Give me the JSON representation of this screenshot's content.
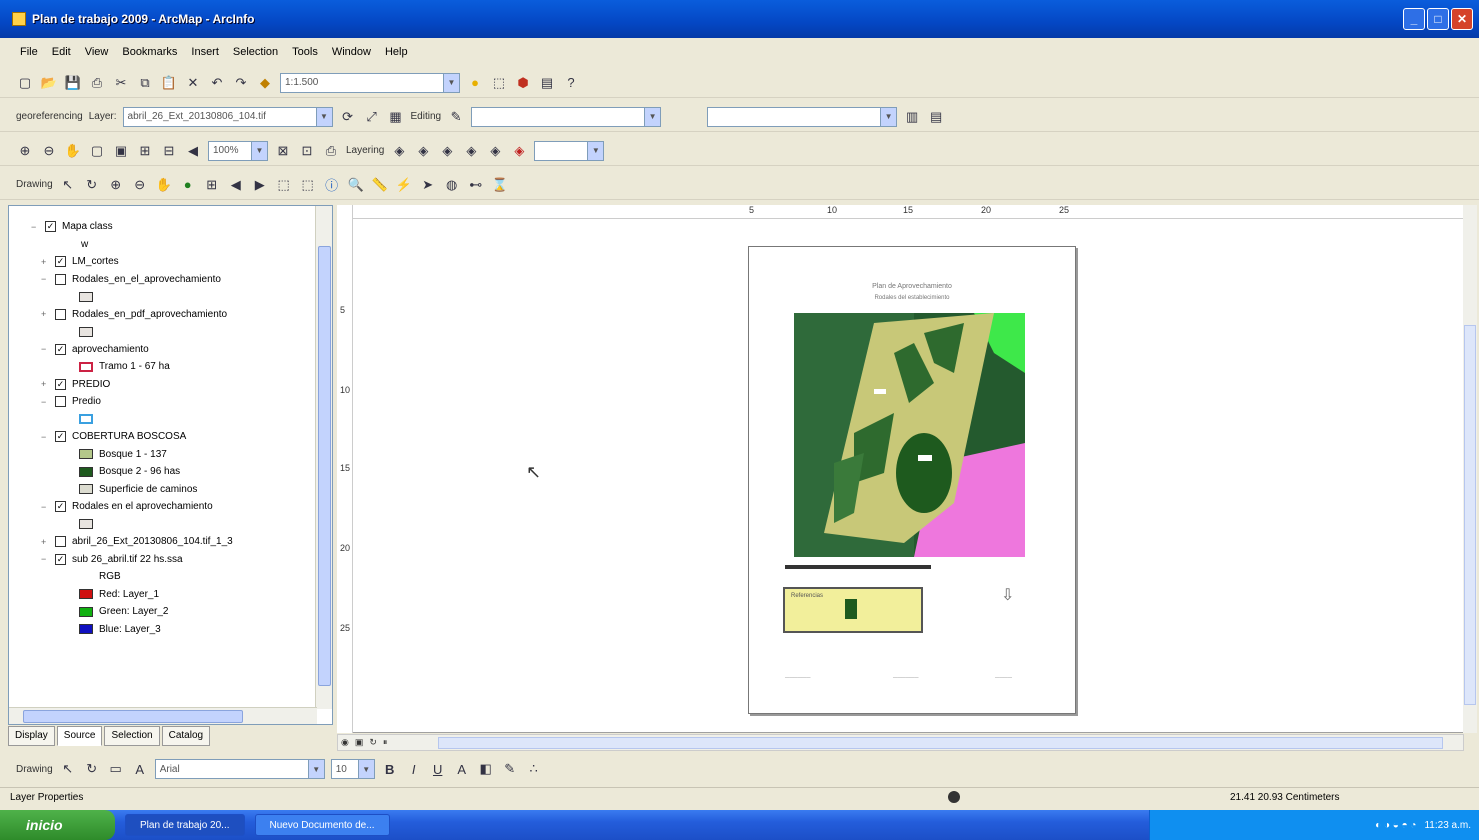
{
  "window": {
    "title": "Plan de trabajo 2009 - ArcMap - ArcInfo"
  },
  "menu": [
    "File",
    "Edit",
    "View",
    "Bookmarks",
    "Insert",
    "Selection",
    "Tools",
    "Window",
    "Help"
  ],
  "toolbar1": {
    "scale": "1:1.500"
  },
  "toolbar2": {
    "label": "georeferencing",
    "layer": "Layer:",
    "layer_value": "abril_26_Ext_20130806_104.tif",
    "task": "Editing"
  },
  "toolbar3": {
    "zoom": "100%",
    "layering": "Layering"
  },
  "toolbar4": {
    "label": "Drawing"
  },
  "toc": {
    "items": [
      {
        "label": "Mapa class",
        "type": "group",
        "checked": true
      },
      {
        "label": "w",
        "type": "text"
      },
      {
        "label": "LM_cortes",
        "type": "layer",
        "checked": true
      },
      {
        "label": "Rodales_en_el_aprovechamiento",
        "type": "layer",
        "checked": false
      },
      {
        "label": "",
        "type": "swatch",
        "color": "#e8e4e0"
      },
      {
        "label": "Rodales_en_pdf_aprovechamiento",
        "type": "layer",
        "checked": false
      },
      {
        "label": "",
        "type": "swatch",
        "color": "#e8e4e0"
      },
      {
        "label": "aprovechamiento",
        "type": "group",
        "checked": true
      },
      {
        "label": "Tramo 1 - 67 ha",
        "type": "swatch",
        "color": "#cc2244"
      },
      {
        "label": "PREDIO",
        "type": "layer",
        "checked": true
      },
      {
        "label": "Predio",
        "type": "layer",
        "checked": false
      },
      {
        "label": "",
        "type": "swatch",
        "color": "#3aa0e0"
      },
      {
        "label": "COBERTURA BOSCOSA",
        "type": "group",
        "checked": true
      },
      {
        "label": "Bosque 1 - 137",
        "type": "swatch",
        "color": "#b4c88a"
      },
      {
        "label": "Bosque 2 - 96 has",
        "type": "swatch",
        "color": "#1e5a1e"
      },
      {
        "label": "Superficie de caminos",
        "type": "swatch",
        "color": "#dcdcd0"
      },
      {
        "label": "Rodales en el aprovechamiento",
        "type": "group",
        "checked": true
      },
      {
        "label": "",
        "type": "swatch",
        "color": "#e8e4e0"
      },
      {
        "label": "abril_26_Ext_20130806_104.tif_1_3",
        "type": "layer",
        "checked": false
      },
      {
        "label": "sub 26_abril.tif 22 hs.ssa",
        "type": "group",
        "checked": true
      },
      {
        "label": "RGB",
        "type": "text"
      },
      {
        "label": "Red: Layer_1",
        "type": "swatch",
        "color": "#d01010"
      },
      {
        "label": "Green: Layer_2",
        "type": "swatch",
        "color": "#10b010"
      },
      {
        "label": "Blue: Layer_3",
        "type": "swatch",
        "color": "#1010c0"
      }
    ],
    "tabs": [
      "Display",
      "Source",
      "Selection",
      "Catalog"
    ]
  },
  "ruler": {
    "top": [
      "5",
      "10",
      "15",
      "20",
      "25"
    ],
    "left": [
      "5",
      "10",
      "15",
      "20",
      "25"
    ]
  },
  "layout": {
    "title": "Plan de Aprovechamiento",
    "subtitle": "Rodales del establecimiento",
    "legend": "Referencias"
  },
  "drawing": {
    "label": "Drawing",
    "font": "Arial",
    "size": "10"
  },
  "status": {
    "left": "Layer Properties",
    "coords": "21.41 20.93 Centimeters"
  },
  "taskbar": {
    "start": "inicio",
    "tasks": [
      "Plan de trabajo 20...",
      "Nuevo Documento de..."
    ],
    "clock": "11:23 a.m."
  }
}
